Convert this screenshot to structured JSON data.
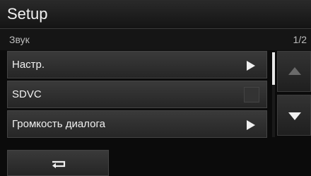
{
  "header": {
    "title": "Setup"
  },
  "sub_header": {
    "title": "Звук",
    "page_indicator": "1/2"
  },
  "menu": {
    "items": [
      {
        "label": "Настр.",
        "control": "arrow-right-icon"
      },
      {
        "label": "SDVC",
        "control": "checkbox",
        "checked": false
      },
      {
        "label": "Громкость диалога",
        "control": "arrow-right-icon"
      }
    ]
  },
  "scroll": {
    "up_enabled": false,
    "down_enabled": true,
    "position": 0.0
  },
  "footer": {
    "back_icon": "return-arrow-icon"
  },
  "colors": {
    "background": "#0b0b0b",
    "button": "#2f2f2f",
    "text": "#f0f0f0",
    "disabled_arrow": "#6a6a6a"
  }
}
